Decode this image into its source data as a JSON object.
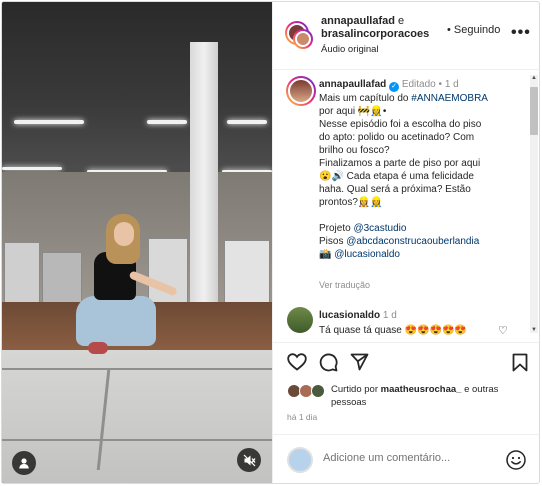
{
  "header": {
    "user1": "annapaullafad",
    "conj": "e",
    "user2": "brasalincorporacoes",
    "audio": "Áudio original",
    "bullet": "•",
    "follow": "Seguindo",
    "more": "•••"
  },
  "caption": {
    "username": "annapaullafad",
    "edited": "Editado",
    "age": "1 d",
    "line1": "Mais um capítulo do",
    "hashtag": "#ANNAEMOBRA",
    "line2": "por aqui 🚧👷‍♀️•",
    "line3": "Nesse episódio foi a escolha do piso",
    "line4": "do apto: polido ou acetinado? Com",
    "line5": "brilho ou fosco?",
    "line6": "Finalizamos a parte de piso por aqui",
    "line7": "😮🔊 Cada etapa é uma felicidade",
    "line8": "haha. Qual será a próxima? Estão",
    "line9": "prontos?👷‍♀️👷‍♀️",
    "credit1_label": "Projeto",
    "credit1_tag": "@3castudio",
    "credit2_label": "Pisos",
    "credit2_tag": "@abcdaconstrucaouberlandia",
    "credit3_emoji": "📸",
    "credit3_tag": "@lucasionaldo",
    "translate": "Ver tradução"
  },
  "comment": {
    "username": "lucasionaldo",
    "age": "1 d",
    "text": "Tá quase tá quase 😍😍😍😍😍"
  },
  "likes": {
    "prefix": "Curtido por",
    "user": "maatheusrochaa_",
    "suffix": "e outras",
    "line2": "pessoas"
  },
  "time": "há 1 dia",
  "add_comment": {
    "placeholder": "Adicione um comentário..."
  },
  "colors": {
    "link": "#00376b",
    "muted": "#8e8e8e",
    "verified": "#0095f6"
  },
  "icons": [
    "user-icon",
    "mute-icon",
    "heart-icon",
    "comment-icon",
    "share-icon",
    "bookmark-icon",
    "emoji-icon",
    "verified-icon"
  ]
}
